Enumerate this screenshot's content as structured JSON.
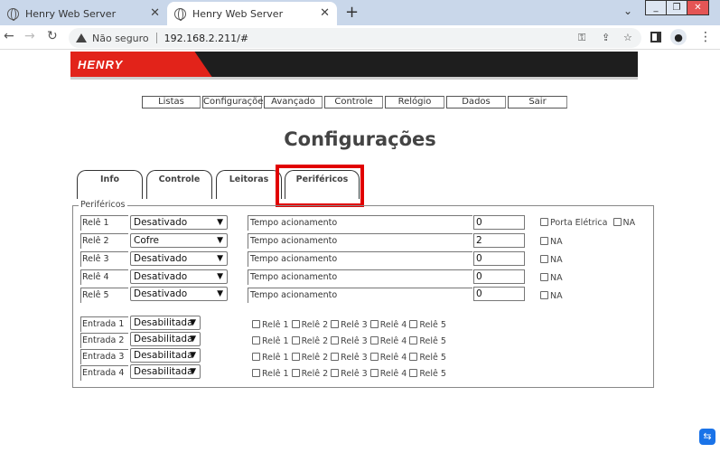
{
  "browser": {
    "tabs": [
      {
        "title": "Henry Web Server"
      },
      {
        "title": "Henry Web Server"
      }
    ],
    "new_tab": "+",
    "not_secure": "Não seguro",
    "url": "192.168.2.211/#"
  },
  "banner": {
    "logo": "HENRY"
  },
  "menu": [
    "Listas",
    "Configurações",
    "Avançado",
    "Controle",
    "Relógio",
    "Dados",
    "Sair"
  ],
  "title": "Configurações",
  "tabs": [
    "Info",
    "Controle",
    "Leitoras",
    "Periféricos"
  ],
  "active_tab": "Periféricos",
  "section": {
    "legend": "Periféricos",
    "time_label": "Tempo acionamento",
    "reles": [
      {
        "label": "Relê 1",
        "mode": "Desativado",
        "time": "0",
        "extra": [
          "Porta Elétrica",
          "NA"
        ]
      },
      {
        "label": "Relê 2",
        "mode": "Cofre",
        "time": "2",
        "extra": [
          "NA"
        ]
      },
      {
        "label": "Relê 3",
        "mode": "Desativado",
        "time": "0",
        "extra": [
          "NA"
        ]
      },
      {
        "label": "Relê 4",
        "mode": "Desativado",
        "time": "0",
        "extra": [
          "NA"
        ]
      },
      {
        "label": "Relê 5",
        "mode": "Desativado",
        "time": "0",
        "extra": [
          "NA"
        ]
      }
    ],
    "entradas": [
      {
        "label": "Entrada 1",
        "mode": "Desabilitada",
        "reles": [
          "Relê 1",
          "Relê 2",
          "Relê 3",
          "Relê 4",
          "Relê 5"
        ]
      },
      {
        "label": "Entrada 2",
        "mode": "Desabilitada",
        "reles": [
          "Relê 1",
          "Relê 2",
          "Relê 3",
          "Relê 4",
          "Relê 5"
        ]
      },
      {
        "label": "Entrada 3",
        "mode": "Desabilitada",
        "reles": [
          "Relê 1",
          "Relê 2",
          "Relê 3",
          "Relê 4",
          "Relê 5"
        ]
      },
      {
        "label": "Entrada 4",
        "mode": "Desabilitada",
        "reles": [
          "Relê 1",
          "Relê 2",
          "Relê 3",
          "Relê 4",
          "Relê 5"
        ]
      }
    ]
  },
  "colors": {
    "highlight": "#e10000",
    "brand": "#e2231a"
  }
}
